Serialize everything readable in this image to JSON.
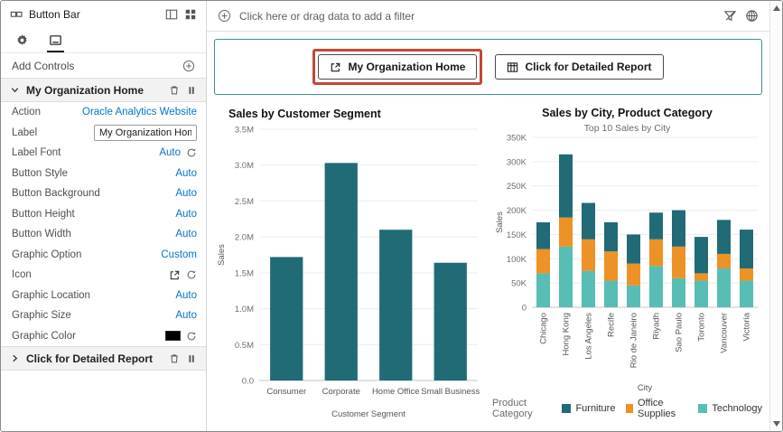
{
  "panel": {
    "title": "Button Bar",
    "add_controls_label": "Add Controls",
    "section_home": {
      "title": "My Organization Home"
    },
    "section_report": {
      "title": "Click for Detailed Report"
    },
    "props": {
      "action": {
        "label": "Action",
        "value": "Oracle Analytics Website"
      },
      "label": {
        "label": "Label",
        "value": "My Organization Hom"
      },
      "label_font": {
        "label": "Label Font",
        "value": "Auto"
      },
      "button_style": {
        "label": "Button Style",
        "value": "Auto"
      },
      "button_background": {
        "label": "Button Background",
        "value": "Auto"
      },
      "button_height": {
        "label": "Button Height",
        "value": "Auto"
      },
      "button_width": {
        "label": "Button Width",
        "value": "Auto"
      },
      "graphic_option": {
        "label": "Graphic Option",
        "value": "Custom"
      },
      "icon": {
        "label": "Icon"
      },
      "graphic_location": {
        "label": "Graphic Location",
        "value": "Auto"
      },
      "graphic_size": {
        "label": "Graphic Size",
        "value": "Auto"
      },
      "graphic_color": {
        "label": "Graphic Color",
        "swatch_color": "#000000"
      }
    }
  },
  "filter_bar": {
    "placeholder": "Click here or drag data to add a filter"
  },
  "canvas_buttons": {
    "home": {
      "label": "My Organization Home"
    },
    "report": {
      "label": "Click for Detailed Report"
    }
  },
  "colors": {
    "link_blue": "#0572CE",
    "annotation_red": "#C74634",
    "viz_border_teal": "#3E8E9B",
    "bar_teal": "#206B76",
    "orange": "#ED9226",
    "turquoise": "#58BDB5"
  },
  "chart_data": [
    {
      "type": "bar",
      "title": "Sales by Customer Segment",
      "categories": [
        "Consumer",
        "Corporate",
        "Home Office",
        "Small Business"
      ],
      "values": [
        1.72,
        3.03,
        2.1,
        1.64
      ],
      "xlabel": "Customer Segment",
      "ylabel": "Sales",
      "ylim": [
        0,
        3.5
      ],
      "ytick_values": [
        0,
        0.5,
        1,
        1.5,
        2,
        2.5,
        3,
        3.5
      ],
      "ytick_labels": [
        "0.0",
        "0.5M",
        "1.0M",
        "1.5M",
        "2.0M",
        "2.5M",
        "3.0M",
        "3.5M"
      ],
      "bar_color": "#206B76",
      "grid": true,
      "legend": "none"
    },
    {
      "type": "stacked-bar",
      "title": "Sales by City, Product Category",
      "subtitle": "Top 10 Sales by City",
      "categories": [
        "Chicago",
        "Hong Kong",
        "Los Angeles",
        "Recife",
        "Rio de Janeiro",
        "Riyadh",
        "Sao Paulo",
        "Toronto",
        "Vancouver",
        "Victoria"
      ],
      "series": [
        {
          "name": "Technology",
          "color": "#58BDB5",
          "values": [
            70,
            125,
            75,
            55,
            45,
            85,
            60,
            55,
            80,
            55
          ]
        },
        {
          "name": "Office Supplies",
          "color": "#ED9226",
          "values": [
            50,
            60,
            65,
            60,
            45,
            55,
            65,
            15,
            30,
            25
          ]
        },
        {
          "name": "Furniture",
          "color": "#206B76",
          "values": [
            55,
            130,
            75,
            60,
            60,
            55,
            75,
            75,
            70,
            80
          ]
        }
      ],
      "legend_title": "Product Category",
      "legend_order": [
        "Furniture",
        "Office Supplies",
        "Technology"
      ],
      "legend_position": "bottom",
      "xlabel": "City",
      "ylabel": "Sales",
      "ylim": [
        0,
        350
      ],
      "ytick_values": [
        0,
        50,
        100,
        150,
        200,
        250,
        300,
        350
      ],
      "ytick_labels": [
        "0",
        "50K",
        "100K",
        "150K",
        "200K",
        "250K",
        "300K",
        "350K"
      ],
      "grid": true
    }
  ]
}
